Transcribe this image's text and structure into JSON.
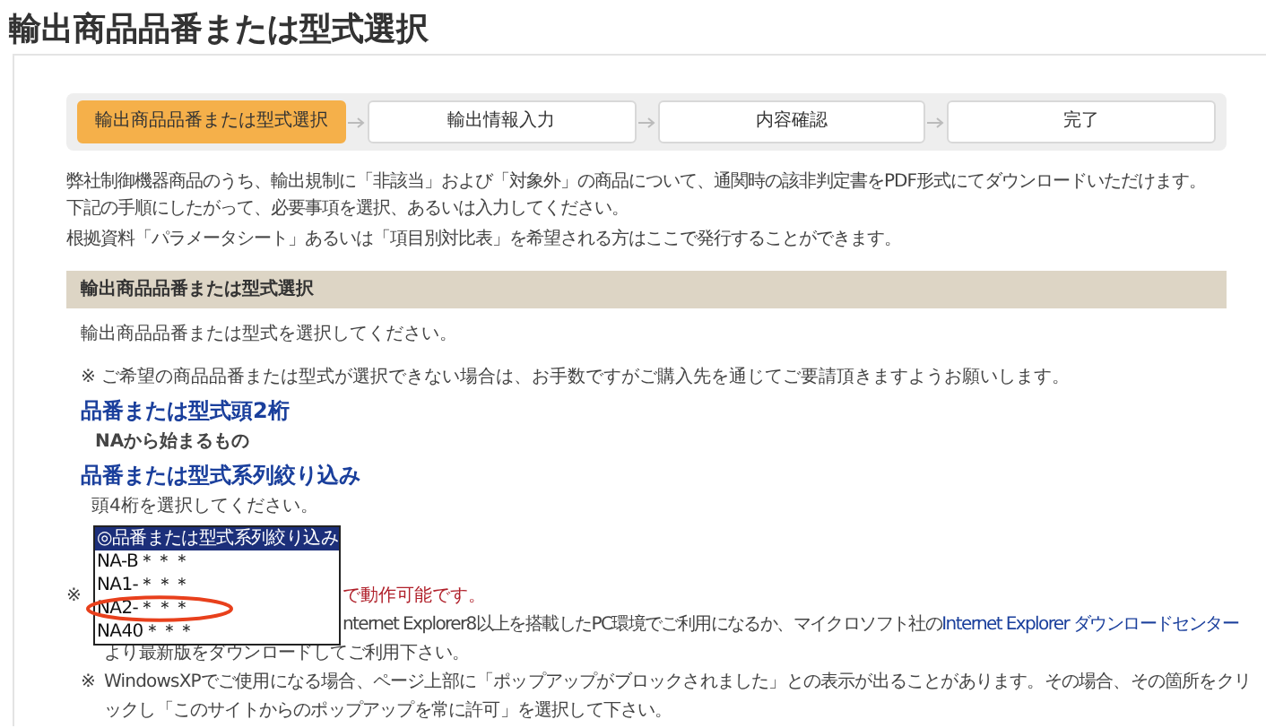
{
  "title": "輸出商品品番または型式選択",
  "steps": [
    {
      "label": "輸出商品品番または型式選択",
      "selected": true
    },
    {
      "label": "輸出情報入力",
      "selected": false
    },
    {
      "label": "内容確認",
      "selected": false
    },
    {
      "label": "完了",
      "selected": false
    }
  ],
  "intro": [
    "弊社制御機器商品のうち、輸出規制に「非該当」および「対象外」の商品について、通関時の該非判定書をPDF形式にてダウンロードいただけます。",
    "下記の手順にしたがって、必要事項を選択、あるいは入力してください。",
    "根拠資料「パラメータシート」あるいは「項目別対比表」を希望される方はここで発行することができます。"
  ],
  "section": {
    "header": "輸出商品品番または型式選択",
    "instruction": "輸出商品品番または型式を選択してください。",
    "note": "※ ご希望の商品品番または型式が選択できない場合は、お手数ですがご購入先を通じてご要請頂きますようお願いします。",
    "prefix": {
      "heading": "品番または型式頭2桁",
      "value": "NAから始まるもの"
    },
    "series": {
      "heading": "品番または型式系列絞り込み",
      "hint": "頭4桁を選択してください。",
      "options": [
        {
          "label": "◎品番または型式系列絞り込み",
          "selected": true
        },
        {
          "label": "NA-B＊＊＊",
          "selected": false
        },
        {
          "label": "NA1-＊＊＊",
          "selected": false
        },
        {
          "label": "NA2-＊＊＊",
          "selected": false,
          "circled": true
        },
        {
          "label": "NA40＊＊＊",
          "selected": false
        }
      ]
    }
  },
  "notes": [
    {
      "mark": "※",
      "text": "で動作可能です。"
    },
    {
      "text": "nternet Explorer8以上を搭載したPC環境でご利用になるか、マイクロソフト社の",
      "link": "Internet Explorer ダウンロードセンター",
      "rest": "より最新版をダウンロードしてご利用下さい。"
    },
    {
      "mark": "※",
      "text": "WindowsXPでご使用になる場合、ページ上部に「ポップアップがブロックされました」との表示が出ることがあります。その場合、その箇所をクリックし「このサイトからのポップアップを常に許可」を選択して下さい。"
    }
  ]
}
